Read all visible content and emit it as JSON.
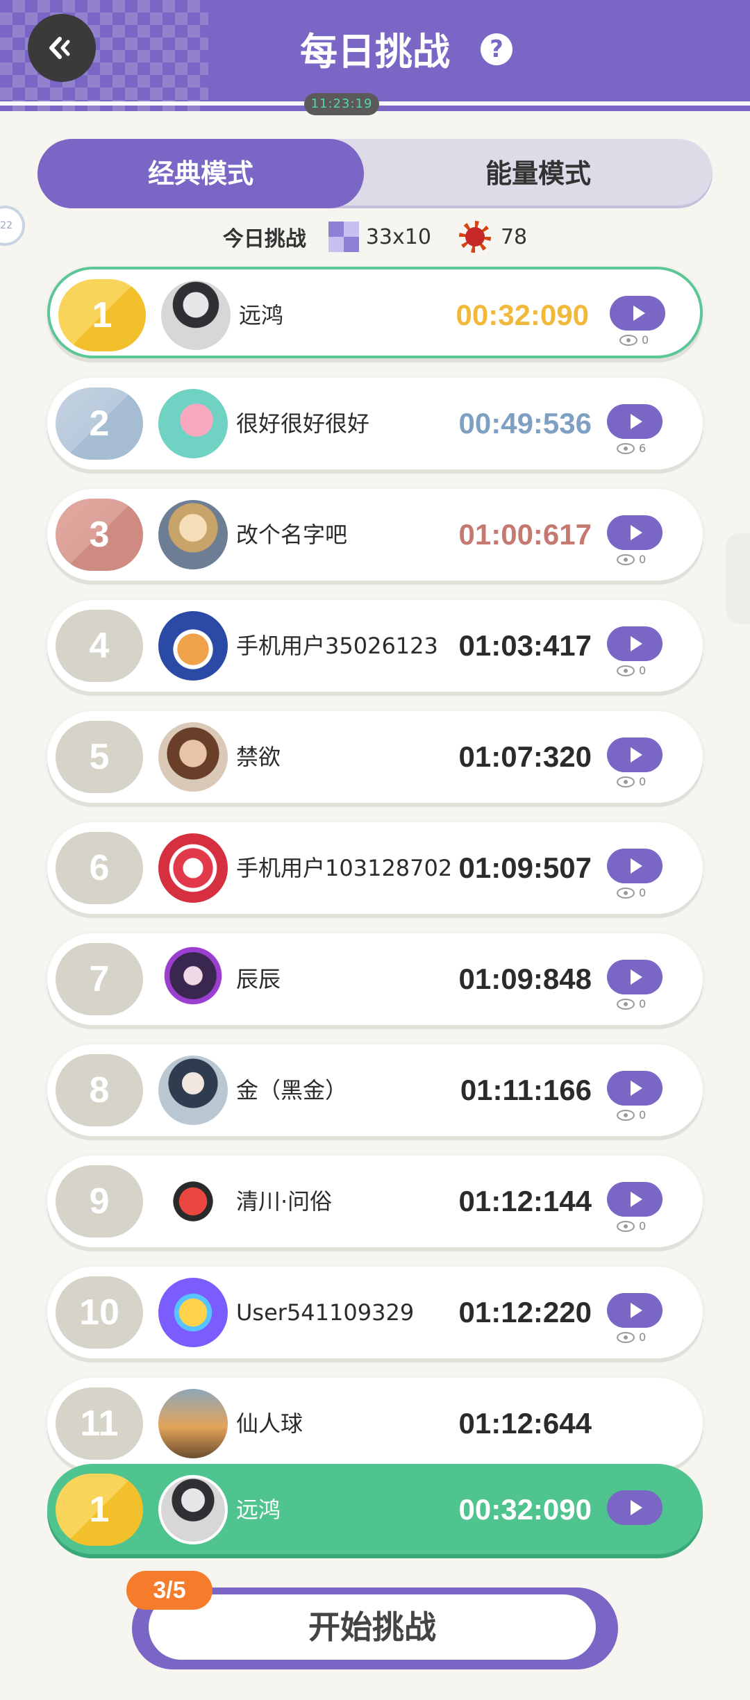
{
  "header": {
    "title": "每日挑战",
    "help_glyph": "?",
    "pill_text": "11:23:19"
  },
  "tabs": {
    "classic": "经典模式",
    "energy": "能量模式",
    "active": "classic"
  },
  "side_badge": "22",
  "today": {
    "label": "今日挑战",
    "board_size": "33x10",
    "mines": "78",
    "board_icon": "grid-icon",
    "mine_icon": "mine-icon"
  },
  "leaderboard": [
    {
      "rank": "1",
      "name": "远鸿",
      "time": "00:32:090",
      "views": "0",
      "medal": "gold"
    },
    {
      "rank": "2",
      "name": "很好很好很好",
      "time": "00:49:536",
      "views": "6",
      "medal": "silver"
    },
    {
      "rank": "3",
      "name": "改个名字吧",
      "time": "01:00:617",
      "views": "0",
      "medal": "bronze"
    },
    {
      "rank": "4",
      "name": "手机用户35026123",
      "time": "01:03:417",
      "views": "0",
      "medal": "none"
    },
    {
      "rank": "5",
      "name": "禁欲",
      "time": "01:07:320",
      "views": "0",
      "medal": "none"
    },
    {
      "rank": "6",
      "name": "手机用户103128702",
      "time": "01:09:507",
      "views": "0",
      "medal": "none"
    },
    {
      "rank": "7",
      "name": "辰辰",
      "time": "01:09:848",
      "views": "0",
      "medal": "none"
    },
    {
      "rank": "8",
      "name": "金（黑金）",
      "time": "01:11:166",
      "views": "0",
      "medal": "none"
    },
    {
      "rank": "9",
      "name": "清川·问俗",
      "time": "01:12:144",
      "views": "0",
      "medal": "none"
    },
    {
      "rank": "10",
      "name": "User541109329",
      "time": "01:12:220",
      "views": "0",
      "medal": "none"
    },
    {
      "rank": "11",
      "name": "仙人球",
      "time": "01:12:644",
      "views": "",
      "medal": "none"
    }
  ],
  "my_entry": {
    "rank": "1",
    "name": "远鸿",
    "time": "00:32:090"
  },
  "start": {
    "label": "开始挑战",
    "attempts": "3/5"
  },
  "colors": {
    "brand_purple": "#7a66c4",
    "highlight_green": "#4fc48f",
    "gold": "#f2b83a",
    "silver": "#7ea0c2",
    "bronze": "#c47a70",
    "attempts_orange": "#f47c2a"
  }
}
